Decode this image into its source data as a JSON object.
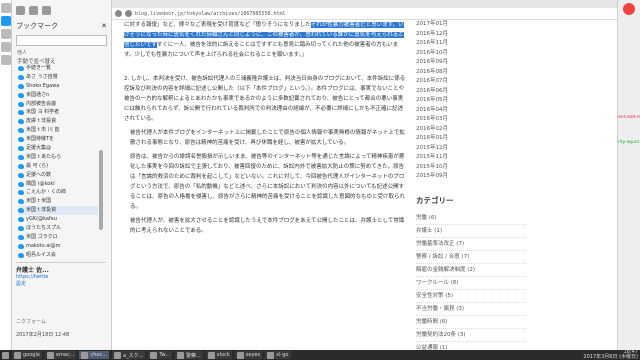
{
  "sidebar": {
    "title": "ブックマーク",
    "sub": "他人",
    "group": "手動で並べ替え",
    "items": [
      "手続き一覧",
      "あさ うさ自慢",
      "Shoko Egawa",
      "米国通さn",
      "内部被告会議",
      "米国 ヨ 科学者",
      "皮膚 t 非投資",
      "米国 t 市 川 首",
      "米国待機Tを",
      "足援大集@",
      "米国 t あたもら",
      "最 可 (ら)",
      "足援への数",
      "隣国 (@kokl",
      "こえんか・くの郎",
      "米国 t 米国",
      "米国 t 非投資",
      "yGK(@kafeu",
      "ほうたちスプル",
      "米国 ゴラクロ",
      "makoto.ai@m",
      "昭島ルイス会"
    ],
    "selected_index": 16,
    "preview_name": "弁護士 佐...",
    "preview_link": "https://twitte",
    "settings": "設定",
    "footer": "ニクフォーム",
    "date": "2017年2月18日 12:48"
  },
  "browser": {
    "url": "blog.livedoor.jp/tokyolaw/archives/1067085558.html"
  },
  "article": {
    "p1_pre": "に対する報復」など、様々なご表現を受け荷度など「懲りそうになりました",
    "p1_hl": "それが性暴力被害者だと思います。いけそうになった時に勇気をくれた詩織さんと同じように、この被害者が、思われている誰かに勇気を与えられると信じたいです",
    "p1_post": "すぐに一人、被告を法的に訴えることはですずとも意見に踏み切ってくれた他の被害者の方もいます。少しでも性暴力について声を上げられる社会になることを願います。」",
    "p2": "2. しかし、本判決を受け、被告訴訟代理人の三浦義隆弁護士は、判決当日自身のブログにおいて、本件訴訟に係る控訴及び判決の内容を詳細に記述し公開した（以下「本件ブログ」という。）。本件ブログには、事実でないことや被告の一方的な解釈によるとあわたかも事実であるかのように多数記載されており、被告にとって都合の悪い事実には触れられておらず、訴公開で行われている裁判所での判決理由の経緯が、不必要に詳細にしかも不正確に記述されている。",
    "p3": "被告代理人が本件ブログをインターネット上に掲載したことで原告の個人情報や事実無根の情報がネット上で拡散される事態となり、原告は精神的苦痛を受け、再び休職を経し、被害が拡大している。",
    "p4": "原告は、被告からの誹謗名誉毀損が示しいまま、被告等のインターネット等を通じた言論によって精神疾患が悪化した事実を今回の訴訟で主張しており、被害回復のために、訴訟内外で被害拡大防止の策に努めてきた。原告は「言論的救済のために裁判を起こして」などいない。これに対して、今回被告代理人がインターネットのブログという方法で、原告の「私的動機」などと述べ、さらに本訴訟において判決の内容以外についても記述公開することは、原告の人格権を侵害し、原告がさらに精神的苦痛を受けることを認識した意図的なものと受け取られる。",
    "p5": "被告代理人が、被害を拡大させることを認識したうえで本件ブログをあえて公開したことは、弁護士として常識的に考えられないことである。"
  },
  "archive": {
    "months": [
      "2017年01月",
      "2016年12月",
      "2016年11月",
      "2016年10月",
      "2016年09月",
      "2016年08月",
      "2016年07月",
      "2016年06月",
      "2016年05月",
      "2016年04月",
      "2016年03月",
      "2016年02月",
      "2016年01月",
      "2015年12月",
      "2015年11月",
      "2015年10月",
      "2015年09月"
    ],
    "cat_title": "カテゴリー",
    "categories": [
      "労働 (6)",
      "弁護士 (1)",
      "労働基準法改正 (7)",
      "警察 / 訴訟 / 合意 (7)",
      "解雇の金銭解決制度 (2)",
      "ワークルール (8)",
      "安全性対策 (5)",
      "不当労働・偏見 (3)",
      "労働時間 (6)",
      "労働契約法20条 (3)",
      "公益通報 (1)"
    ]
  },
  "rightwin": {
    "label1": "ent-add-mysql/unity.te",
    "label2": "nty-wp2016c-2016109"
  },
  "taskbar": {
    "items": [
      "google",
      "emac...",
      "choc...",
      "a_スク...",
      "Tw...",
      "警察...",
      "xlock",
      "seyes",
      "xl-go"
    ],
    "active_index": 2,
    "clock_time": "18:47",
    "clock_date": "2017年3月6日 (木曜日)"
  }
}
